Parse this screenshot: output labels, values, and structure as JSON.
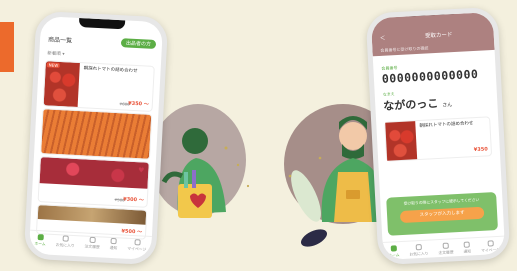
{
  "phone1": {
    "header_title": "商品一覧",
    "header_button": "出品者の方",
    "subheader": "新着順 ▾",
    "cards": [
      {
        "badge": "NEW",
        "title": "朝採れトマトの詰め合わせ",
        "old_price": "¥600",
        "price": "¥350 〜",
        "image": "tomato"
      },
      {
        "badge": "",
        "title": "",
        "old_price": "",
        "price": "",
        "image": "carrot"
      },
      {
        "badge": "",
        "title": "",
        "old_price": "¥500",
        "price": "¥300 〜",
        "image": "apple"
      },
      {
        "badge": "",
        "title": "",
        "old_price": "",
        "price": "¥500 〜",
        "image": "mix"
      }
    ],
    "tabs": [
      "ホーム",
      "お気に入り",
      "注文履歴",
      "通知",
      "マイページ"
    ]
  },
  "phone2": {
    "header_back": "＜",
    "header_title": "受取カード",
    "header_sub": "会員番号と受け取りの確認",
    "number_label": "会員番号",
    "member_number": "0000000000000",
    "name_label": "なまえ",
    "name": "ながのっこ",
    "name_suffix": "さん",
    "product_title": "朝採れトマトの詰め合わせ",
    "product_price": "¥350",
    "box_label": "受け取りの際にスタッフに提示してください",
    "box_button": "スタッフが入力します",
    "tabs": [
      "ホーム",
      "お気に入り",
      "注文履歴",
      "通知",
      "マイページ"
    ]
  },
  "icons": [
    "heart-icon",
    "tab-icon"
  ],
  "colors": {
    "accent_green": "#5cae45",
    "accent_orange": "#ec6a2c",
    "header_mauve": "#ad8180",
    "sale_red": "#e9543a"
  }
}
